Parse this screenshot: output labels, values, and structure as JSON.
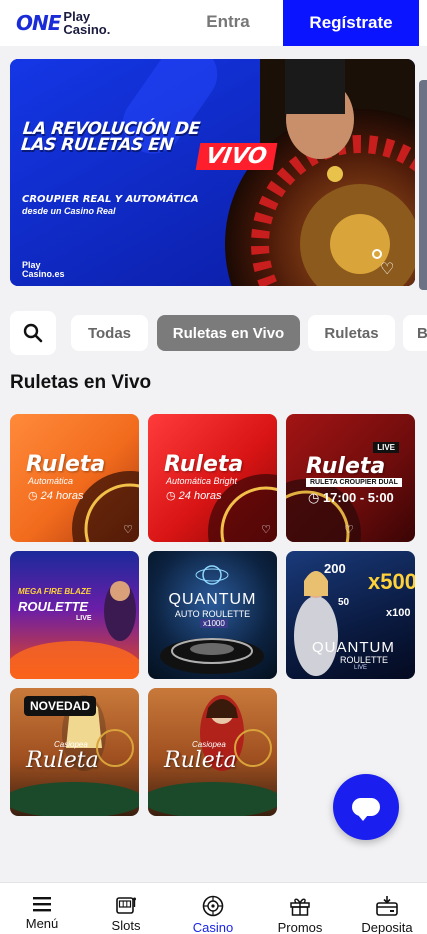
{
  "header": {
    "logo_one": "ONE",
    "logo_line1": "Play",
    "logo_line2": "Casino.",
    "login_label": "Entra",
    "register_label": "Regístrate"
  },
  "hero": {
    "title_line1": "La revolución de",
    "title_line2": "las ruletas en",
    "highlight": "VIVO",
    "subtitle": "Croupier real y automática",
    "subtitle2": "desde un Casino Real",
    "logo_line1": "Play",
    "logo_line2": "Casino.es"
  },
  "filters": {
    "chips": [
      "Todas",
      "Ruletas en Vivo",
      "Ruletas",
      "B"
    ],
    "active": "Ruletas en Vivo"
  },
  "section_title": "Ruletas en Vivo",
  "games": [
    {
      "name": "Ruleta",
      "sub": "Automática",
      "hours": "◷ 24 horas"
    },
    {
      "name": "Ruleta",
      "sub": "Automática Bright",
      "hours": "◷ 24 horas"
    },
    {
      "name": "Ruleta",
      "badge": "LIVE",
      "sub": "RULETA CROUPIER DUAL",
      "hours": "◷ 17:00 - 5:00"
    },
    {
      "name": "ROULETTE",
      "pre": "MEGA FIRE BLAZE",
      "sub": "LIVE"
    },
    {
      "name": "QUANTUM",
      "sub": "AUTO ROULETTE",
      "mult": "x1000"
    },
    {
      "name": "QUANTUM",
      "sub": "ROULETTE",
      "sub2": "LIVE",
      "m1": "200",
      "m2": "x500",
      "m3": "50",
      "m4": "x100"
    },
    {
      "name": "Ruleta",
      "pre": "Casiopea",
      "badge": "NOVEDAD"
    },
    {
      "name": "Ruleta",
      "pre": "Casiopea"
    }
  ],
  "nav": [
    {
      "label": "Menú",
      "icon": "menu-icon"
    },
    {
      "label": "Slots",
      "icon": "slot-machine-icon"
    },
    {
      "label": "Casino",
      "icon": "roulette-icon"
    },
    {
      "label": "Promos",
      "icon": "gift-icon"
    },
    {
      "label": "Deposita",
      "icon": "wallet-icon"
    }
  ],
  "colors": {
    "brand_blue": "#0a14ff",
    "nav_active": "#1a24e8"
  }
}
